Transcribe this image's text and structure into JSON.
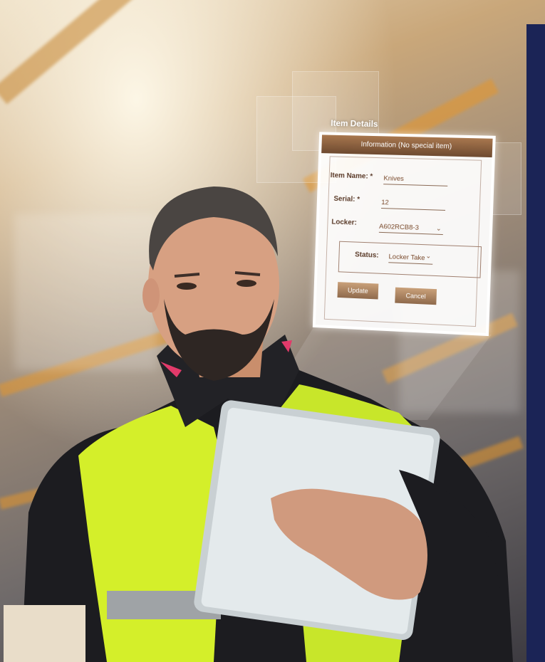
{
  "panel": {
    "title": "Item Details",
    "header": "Information (No special item)",
    "fields": {
      "item_name_label": "Item Name: *",
      "item_name_value": "Knives",
      "serial_label": "Serial: *",
      "serial_value": "12",
      "locker_label": "Locker:",
      "locker_value": "A602RCB8-3",
      "status_label": "Status:",
      "status_value": "Locker Take"
    },
    "buttons": {
      "update": "Update",
      "cancel": "Cancel"
    }
  },
  "colors": {
    "vest": "#d4ef2a",
    "jacket": "#1c1c20",
    "panel_header": "#7a5236",
    "accent_strip": "#1b2456",
    "beam": "#e6962a"
  }
}
